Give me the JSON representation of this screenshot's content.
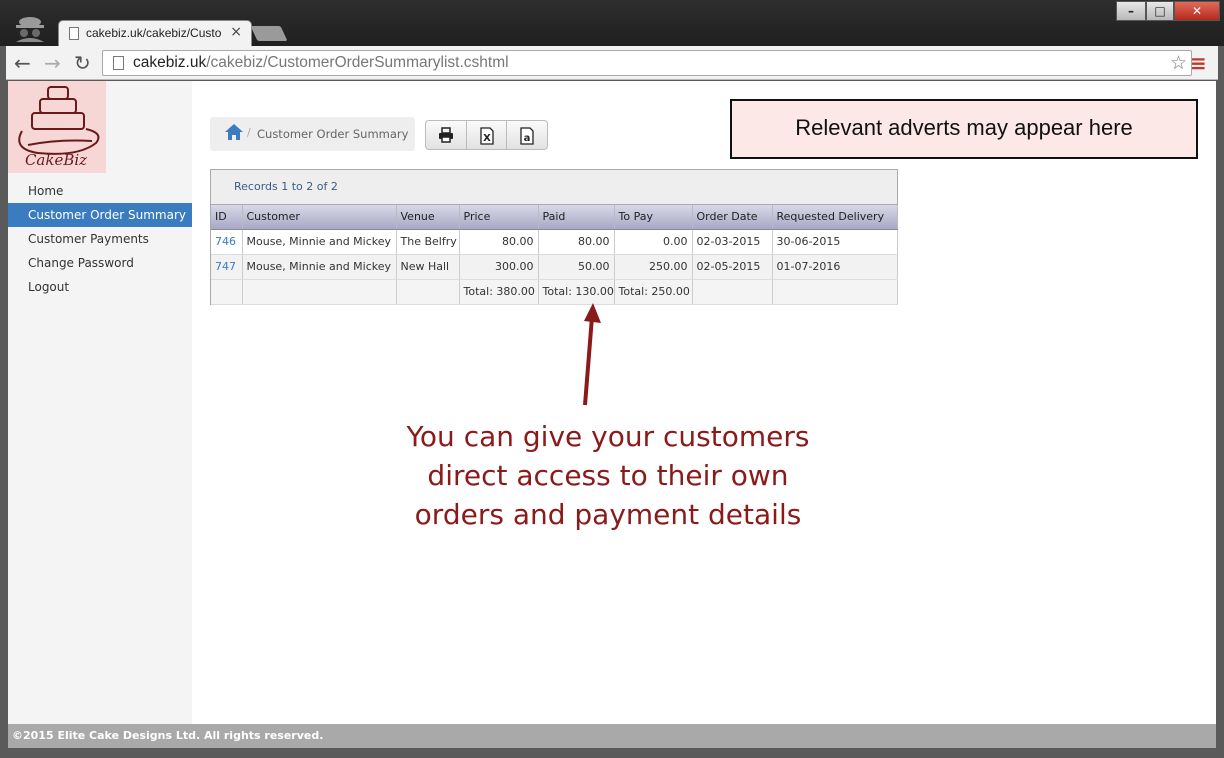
{
  "browser": {
    "tab_title": "cakebiz.uk/cakebiz/Custo",
    "tab_close": "×",
    "url_domain": "cakebiz.uk",
    "url_path": "/cakebiz/CustomerOrderSummarylist.cshtml",
    "back_icon": "arrow-left-icon",
    "forward_icon": "arrow-right-icon",
    "reload_icon": "reload-icon",
    "star_glyph": "☆",
    "menu_glyph": "≡"
  },
  "sidebar": {
    "logo_text": "CakeBiz",
    "items": [
      {
        "label": "Home",
        "active": false
      },
      {
        "label": "Customer Order Summary",
        "active": true
      },
      {
        "label": "Customer Payments",
        "active": false
      },
      {
        "label": "Change Password",
        "active": false
      },
      {
        "label": "Logout",
        "active": false
      }
    ]
  },
  "breadcrumb": {
    "separator": "/",
    "current": "Customer Order Summary"
  },
  "export_buttons": [
    "print-icon",
    "excel-icon",
    "text-export-icon"
  ],
  "advert": {
    "text": "Relevant adverts may appear here"
  },
  "grid": {
    "pager": "Records 1 to 2 of 2",
    "columns": [
      "ID",
      "Customer",
      "Venue",
      "Price",
      "Paid",
      "To Pay",
      "Order Date",
      "Requested Delivery"
    ],
    "rows": [
      {
        "id": "746",
        "customer": "Mouse, Minnie and Mickey",
        "venue": "The Belfry",
        "price": "80.00",
        "paid": "80.00",
        "to_pay": "0.00",
        "order_date": "02-03-2015",
        "delivery": "30-06-2015"
      },
      {
        "id": "747",
        "customer": "Mouse, Minnie and Mickey",
        "venue": "New Hall",
        "price": "300.00",
        "paid": "50.00",
        "to_pay": "250.00",
        "order_date": "02-05-2015",
        "delivery": "01-07-2016"
      }
    ],
    "totals": {
      "price": "Total: 380.00",
      "paid": "Total: 130.00",
      "to_pay": "Total: 250.00"
    }
  },
  "callout": {
    "line1": "You can give your customers",
    "line2": "direct access to their own",
    "line3": "orders and payment details"
  },
  "footer": {
    "text": "©2015 Elite Cake Designs Ltd. All rights reserved."
  },
  "colors": {
    "accent": "#3b7bbf",
    "callout": "#8b1a1a",
    "advert_bg": "#fde8e8"
  }
}
